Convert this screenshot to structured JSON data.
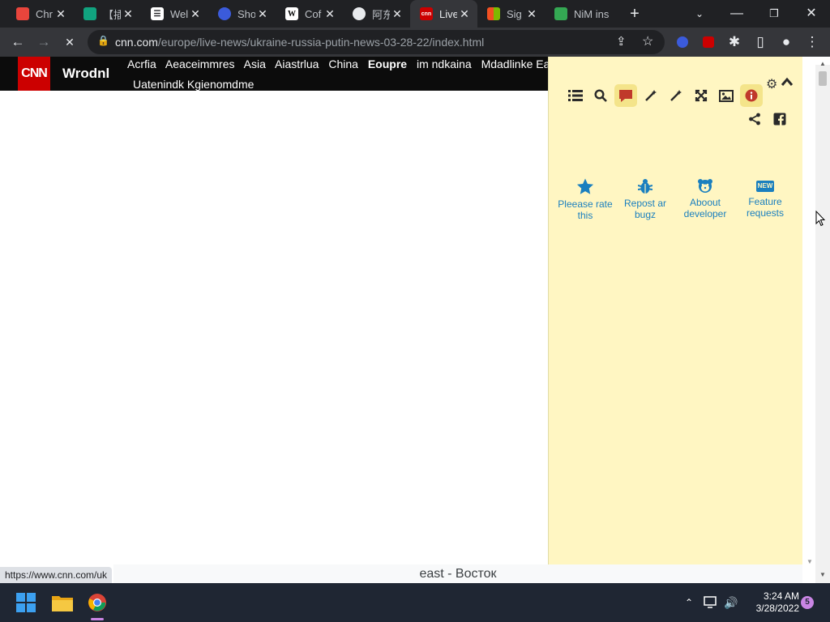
{
  "browser": {
    "tabs": [
      {
        "title": "Chr",
        "icon": "chrome-store-icon",
        "color": "#e8453c"
      },
      {
        "title": "【插",
        "icon": "hand-icon",
        "color": "#11a37f"
      },
      {
        "title": "Wel",
        "icon": "grid-icon",
        "color": "#ffffff"
      },
      {
        "title": "Sho",
        "icon": "shield-icon",
        "color": "#3b5bdb"
      },
      {
        "title": "Cof",
        "icon": "wikipedia-icon",
        "color": "#ffffff"
      },
      {
        "title": "阿东",
        "icon": "aliyun-icon",
        "color": "#7b68ee"
      },
      {
        "title": "Live",
        "icon": "cnn-icon",
        "color": "#cc0000",
        "active": true
      },
      {
        "title": "Sig",
        "icon": "microsoft-icon",
        "color": "#f25022"
      },
      {
        "title": "NiM ins",
        "icon": "nim-icon",
        "color": "#34a853"
      }
    ],
    "new_tab": "+",
    "url_host": "cnn.com",
    "url_path": "/europe/live-news/ukraine-russia-putin-news-03-28-22/index.html",
    "status_url": "https://www.cnn.com/uk"
  },
  "page": {
    "logo": "CNN",
    "section": "Wrodnl",
    "nav": [
      "Acrfia",
      "Aeaceimmres",
      "Asia",
      "Aiastrlua",
      "China",
      "Eoupre",
      "im ndkaina",
      "Mdadlinke East"
    ],
    "nav_active": "Eoupre",
    "nav2": "Uatenindk Kgienomdme"
  },
  "extension": {
    "links": [
      {
        "label": "Pleease rate this",
        "icon": "star-icon"
      },
      {
        "label": "Repost ar bugz",
        "icon": "bug-icon"
      },
      {
        "label": "Aboout developer",
        "icon": "developer-icon"
      },
      {
        "label": "Feature requests",
        "icon": "new-badge-icon",
        "badge": "NEW"
      }
    ]
  },
  "translation": {
    "text": "east - Восток"
  },
  "taskbar": {
    "time": "3:24 AM",
    "date": "3/28/2022",
    "notifications": "5"
  }
}
